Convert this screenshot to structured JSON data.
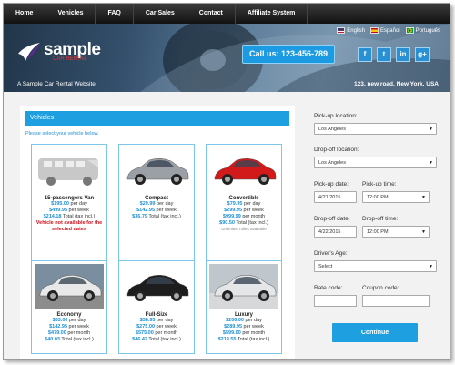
{
  "nav": [
    "Home",
    "Vehicles",
    "FAQ",
    "Car Sales",
    "Contact",
    "Affiliate System"
  ],
  "languages": [
    {
      "label": "English",
      "flag_colors": [
        "#b22234",
        "#ffffff",
        "#3c3b6e"
      ]
    },
    {
      "label": "Español",
      "flag_colors": [
        "#c60b1e",
        "#ffc400",
        "#c60b1e"
      ]
    },
    {
      "label": "Português",
      "flag_colors": [
        "#009c3b",
        "#ffdf00",
        "#002776"
      ]
    }
  ],
  "brand": {
    "name": "sample",
    "sub": "CAR RENTAL",
    "tagline": "A Sample Car Rental Website"
  },
  "phone": "Call us: 123-456-789",
  "address": "123, new road, New York, USA",
  "social": [
    {
      "icon": "facebook-icon",
      "glyph": "f"
    },
    {
      "icon": "twitter-icon",
      "glyph": "t"
    },
    {
      "icon": "linkedin-icon",
      "glyph": "in"
    },
    {
      "icon": "google-plus-icon",
      "glyph": "g+"
    }
  ],
  "vehicles_header": "Vehicles",
  "instruction": "Please select your vehicle below.",
  "cars": [
    {
      "name": "15-passengers Van",
      "color": "#c8c8c8",
      "kind": "van",
      "lines": [
        {
          "price": "$195.00",
          "unit": "per day"
        },
        {
          "price": "$499.95",
          "unit": "per week"
        },
        {
          "price": "$214.18",
          "unit": "Total (tax incl.)"
        }
      ],
      "warning": "Vehicle not available for the selected dates",
      "note": ""
    },
    {
      "name": "Compact",
      "color": "#9aa0a6",
      "kind": "car",
      "lines": [
        {
          "price": "$29.99",
          "unit": "per day"
        },
        {
          "price": "$142.95",
          "unit": "per week"
        },
        {
          "price": "$36.79",
          "unit": "Total (tax incl.)"
        }
      ],
      "warning": "",
      "note": ""
    },
    {
      "name": "Convertible",
      "color": "#d21a1a",
      "kind": "car",
      "lines": [
        {
          "price": "$79.95",
          "unit": "per day"
        },
        {
          "price": "$299.95",
          "unit": "per week"
        },
        {
          "price": "$999.99",
          "unit": "per month"
        },
        {
          "price": "$90.50",
          "unit": "Total (tax incl.)"
        }
      ],
      "warning": "",
      "note": "Unlimited miles available"
    },
    {
      "name": "Economy",
      "color": "#e8e8e8",
      "kind": "car",
      "lines": [
        {
          "price": "$33.00",
          "unit": "per day"
        },
        {
          "price": "$142.95",
          "unit": "per week"
        },
        {
          "price": "$479.00",
          "unit": "per month"
        },
        {
          "price": "$40.03",
          "unit": "Total (tax incl.)"
        }
      ],
      "warning": "",
      "note": ""
    },
    {
      "name": "Full-Size",
      "color": "#1d1d1d",
      "kind": "car",
      "lines": [
        {
          "price": "$38.95",
          "unit": "per day"
        },
        {
          "price": "$275.00",
          "unit": "per week"
        },
        {
          "price": "$575.00",
          "unit": "per month"
        },
        {
          "price": "$46.42",
          "unit": "Total (tax incl.)"
        }
      ],
      "warning": "",
      "note": ""
    },
    {
      "name": "Luxury",
      "color": "#e4e6e8",
      "kind": "car",
      "lines": [
        {
          "price": "$206.00",
          "unit": "per day"
        },
        {
          "price": "$289.95",
          "unit": "per week"
        },
        {
          "price": "$599.00",
          "unit": "per month"
        },
        {
          "price": "$219.55",
          "unit": "Total (tax incl.)"
        }
      ],
      "warning": "",
      "note": ""
    }
  ],
  "form": {
    "pickup_location_label": "Pick-up location:",
    "pickup_location_value": "Los Angeles",
    "dropoff_location_label": "Drop-off location:",
    "dropoff_location_value": "Los Angeles",
    "pickup_date_label": "Pick-up date:",
    "pickup_date_value": "4/21/2015",
    "pickup_time_label": "Pick-up time:",
    "pickup_time_value": "12:00 PM",
    "dropoff_date_label": "Drop-off date:",
    "dropoff_date_value": "4/22/2015",
    "dropoff_time_label": "Drop-off time:",
    "dropoff_time_value": "12:00 PM",
    "driver_age_label": "Driver's Age:",
    "driver_age_value": "Select",
    "rate_code_label": "Rate code:",
    "coupon_code_label": "Coupon code:",
    "continue_label": "Continue"
  }
}
